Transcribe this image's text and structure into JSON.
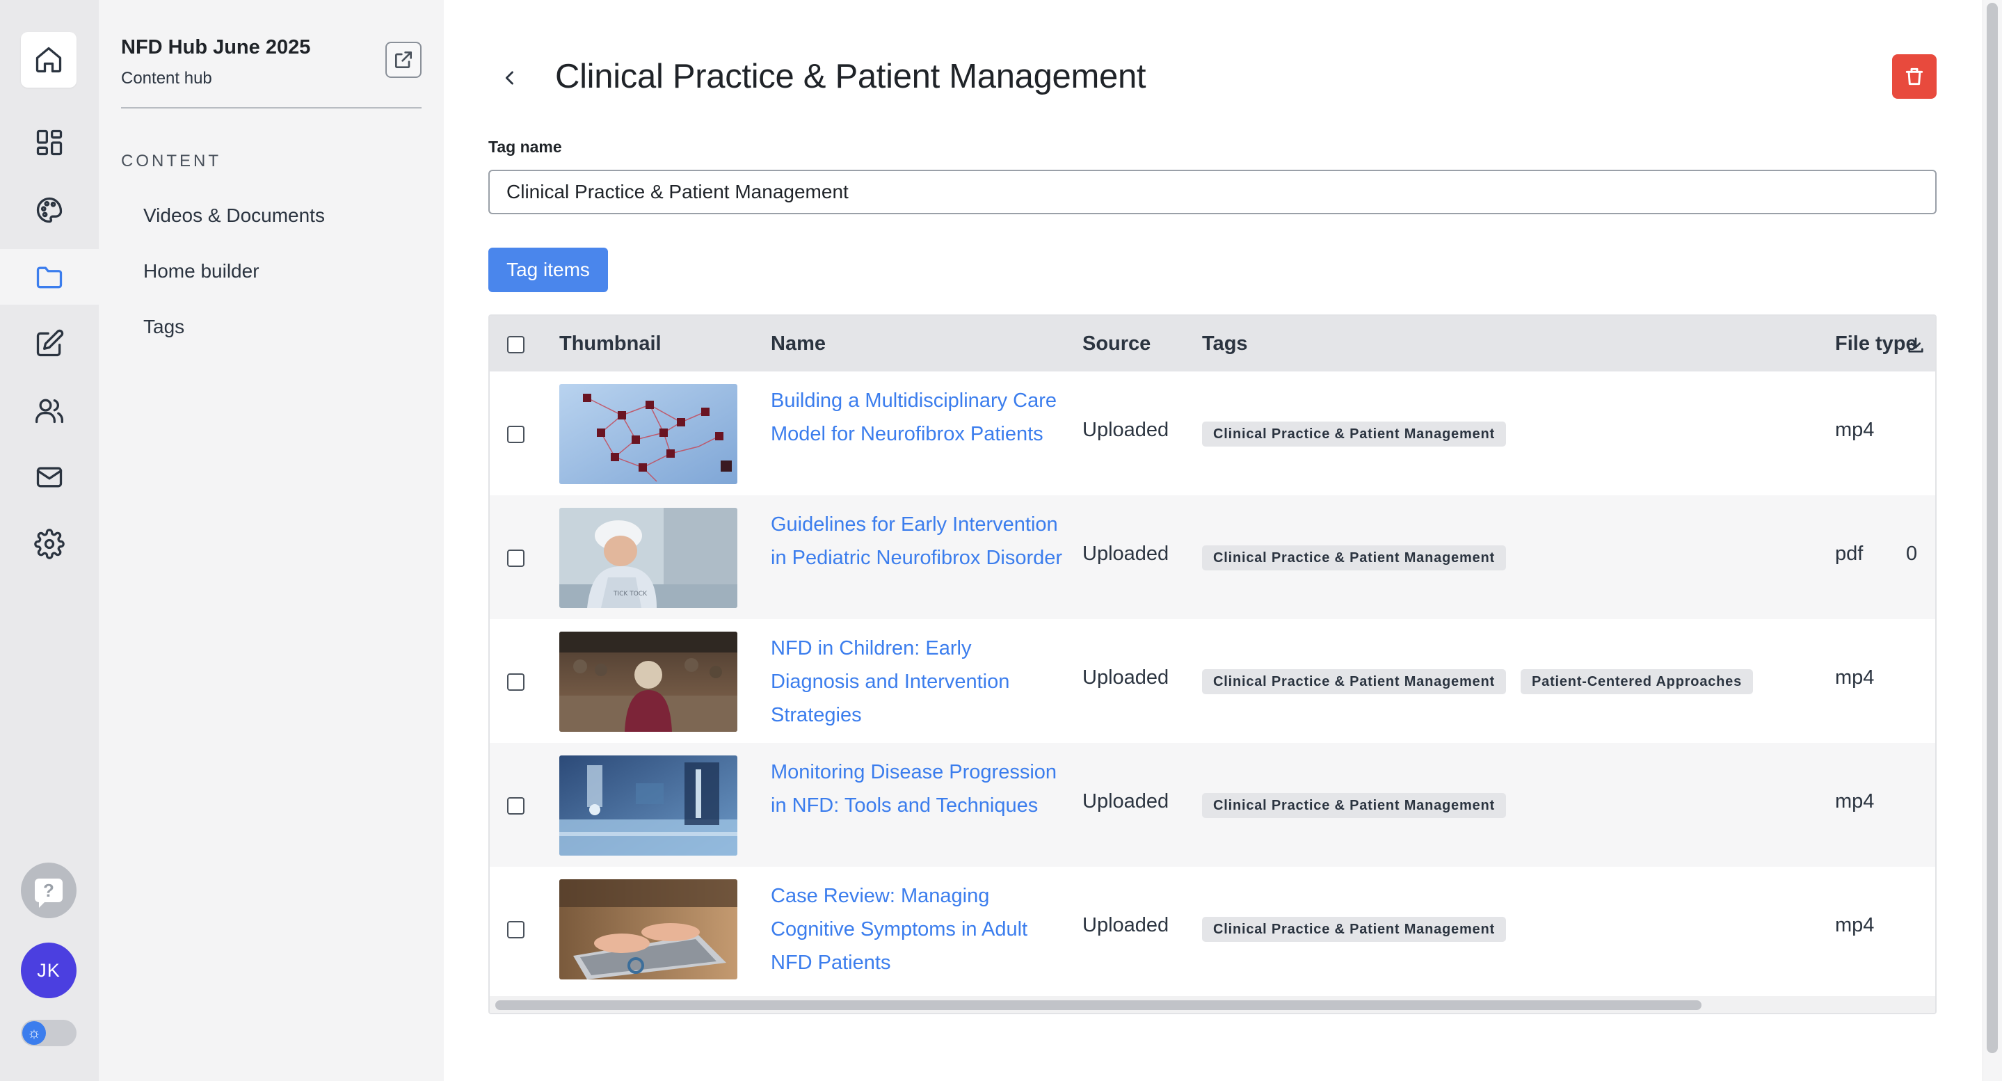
{
  "rail": {
    "icons": [
      "home-icon",
      "dashboard-icon",
      "palette-icon",
      "folder-icon",
      "edit-icon",
      "users-icon",
      "mail-icon",
      "gear-icon"
    ],
    "active": "folder-icon",
    "help_glyph": "?",
    "avatar_initials": "JK",
    "accent_color": "#3b7ded",
    "avatar_color": "#4b3fe0"
  },
  "sidebar": {
    "hub_title": "NFD Hub June 2025",
    "hub_subtitle": "Content hub",
    "section_label": "CONTENT",
    "items": [
      {
        "label": "Videos & Documents"
      },
      {
        "label": "Home builder"
      },
      {
        "label": "Tags"
      }
    ]
  },
  "main": {
    "title": "Clinical Practice & Patient Management",
    "tag_name_label": "Tag name",
    "tag_name_value": "Clinical Practice & Patient Management",
    "tag_items_label": "Tag items",
    "delete_color": "#e84a3d",
    "button_color": "#4a86ec"
  },
  "table": {
    "headers": {
      "thumbnail": "Thumbnail",
      "name": "Name",
      "source": "Source",
      "tags": "Tags",
      "file_type": "File type"
    },
    "rows": [
      {
        "name": "Building a Multidisciplinary Care Model for Neurofibrox Patients",
        "source": "Uploaded",
        "tags": [
          "Clinical Practice & Patient Management"
        ],
        "file_type": "mp4",
        "downloads": "",
        "thumbnail": "network-diagram-image"
      },
      {
        "name": "Guidelines for Early Intervention in Pediatric Neurofibrox Disorder",
        "source": "Uploaded",
        "tags": [
          "Clinical Practice & Patient Management"
        ],
        "file_type": "pdf",
        "downloads": "0",
        "thumbnail": "child-in-hat-image"
      },
      {
        "name": "NFD in Children: Early Diagnosis and Intervention Strategies",
        "source": "Uploaded",
        "tags": [
          "Clinical Practice & Patient Management",
          "Patient-Centered Approaches"
        ],
        "file_type": "mp4",
        "downloads": "",
        "thumbnail": "child-in-crowd-image"
      },
      {
        "name": "Monitoring Disease Progression in NFD: Tools and Techniques",
        "source": "Uploaded",
        "tags": [
          "Clinical Practice & Patient Management"
        ],
        "file_type": "mp4",
        "downloads": "",
        "thumbnail": "lab-equipment-image"
      },
      {
        "name": "Case Review: Managing Cognitive Symptoms in Adult NFD Patients",
        "source": "Uploaded",
        "tags": [
          "Clinical Practice & Patient Management"
        ],
        "file_type": "mp4",
        "downloads": "",
        "thumbnail": "typing-laptop-image"
      }
    ]
  }
}
